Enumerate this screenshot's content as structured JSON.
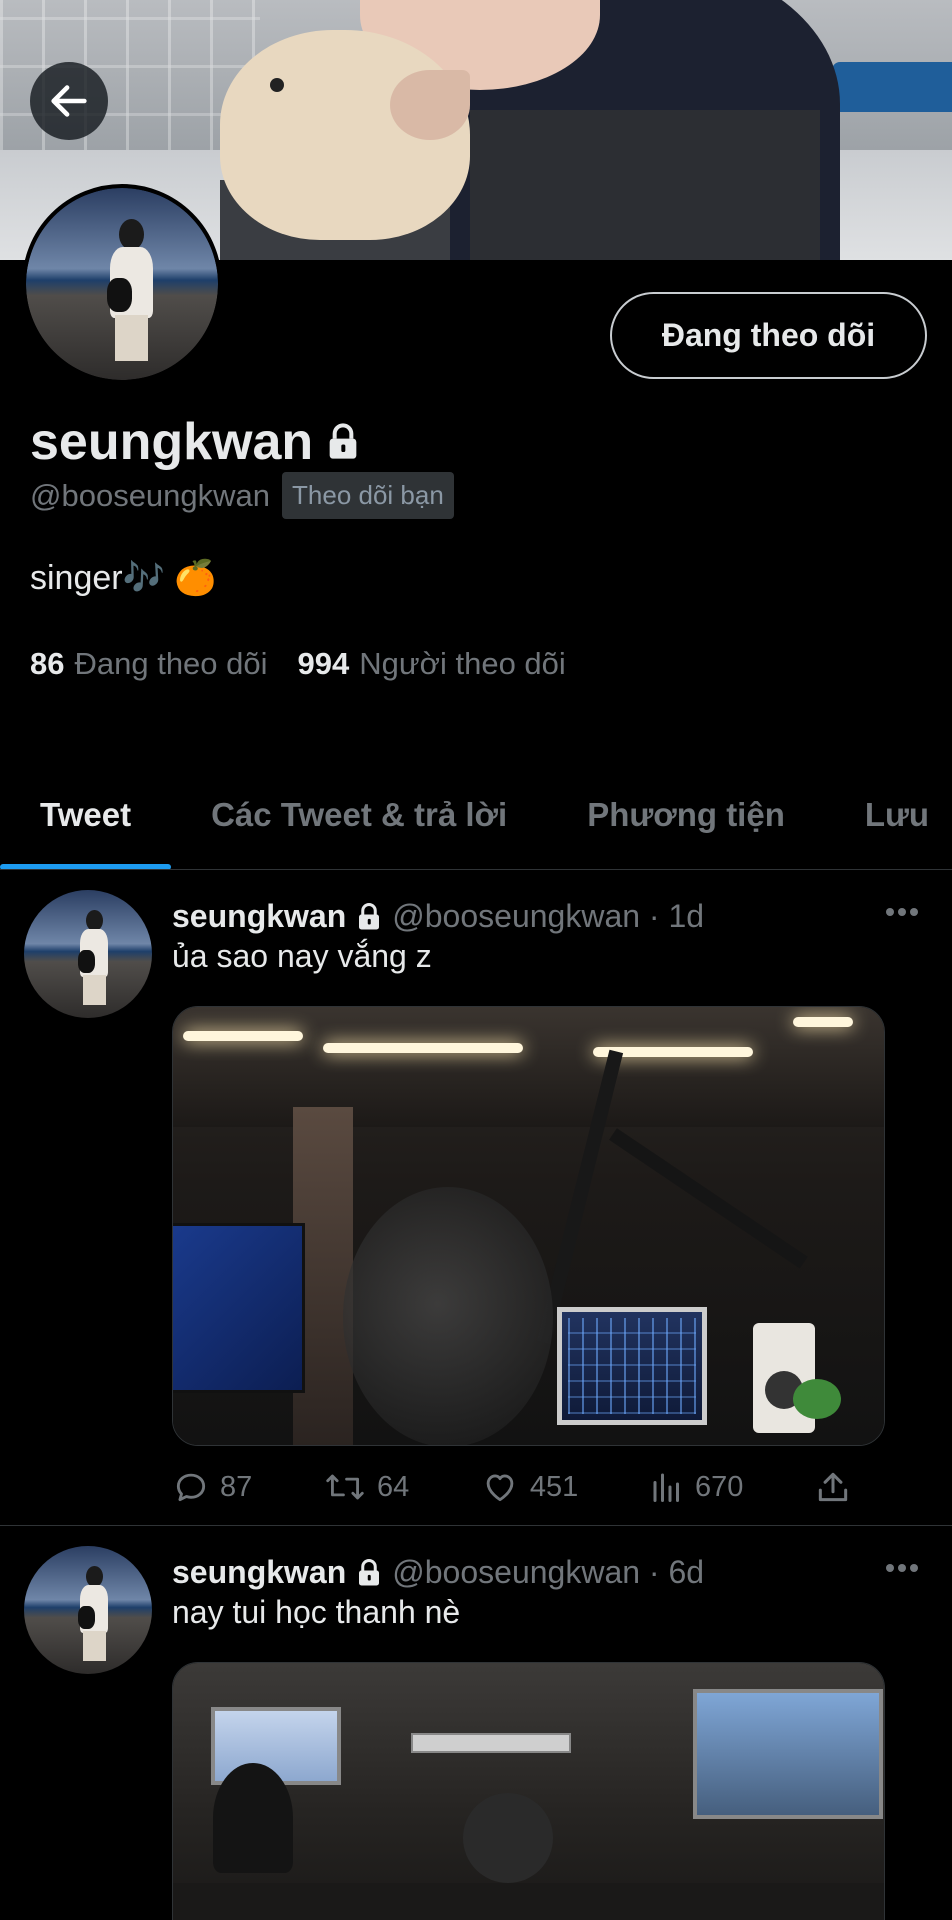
{
  "profile": {
    "display_name": "seungkwan",
    "handle": "@booseungkwan",
    "follows_you_label": "Theo dõi bạn",
    "bio": "singer🎶 🍊",
    "follow_button_label": "Đang theo dõi",
    "following_count": "86",
    "following_label": "Đang theo dõi",
    "followers_count": "994",
    "followers_label": "Người theo dõi"
  },
  "tabs": [
    {
      "label": "Tweet",
      "active": true
    },
    {
      "label": "Các Tweet & trả lời",
      "active": false
    },
    {
      "label": "Phương tiện",
      "active": false
    },
    {
      "label": "Lưu",
      "active": false
    }
  ],
  "tweets": [
    {
      "name": "seungkwan",
      "meta": "@booseungkwan · 1d",
      "text": "ủa sao nay vắng z",
      "replies": "87",
      "retweets": "64",
      "likes": "451",
      "views": "670"
    },
    {
      "name": "seungkwan",
      "meta": "@booseungkwan · 6d",
      "text": "nay tui học thanh nè"
    }
  ],
  "icons": {
    "back": "arrow-left-icon",
    "lock": "lock-icon",
    "more": "more-horizontal-icon",
    "reply": "reply-icon",
    "retweet": "retweet-icon",
    "like": "heart-icon",
    "views": "views-icon",
    "share": "share-icon"
  },
  "colors": {
    "accent": "#1d9bf0",
    "background": "#000000",
    "text_primary": "#e7e9ea",
    "text_secondary": "#71767b"
  }
}
